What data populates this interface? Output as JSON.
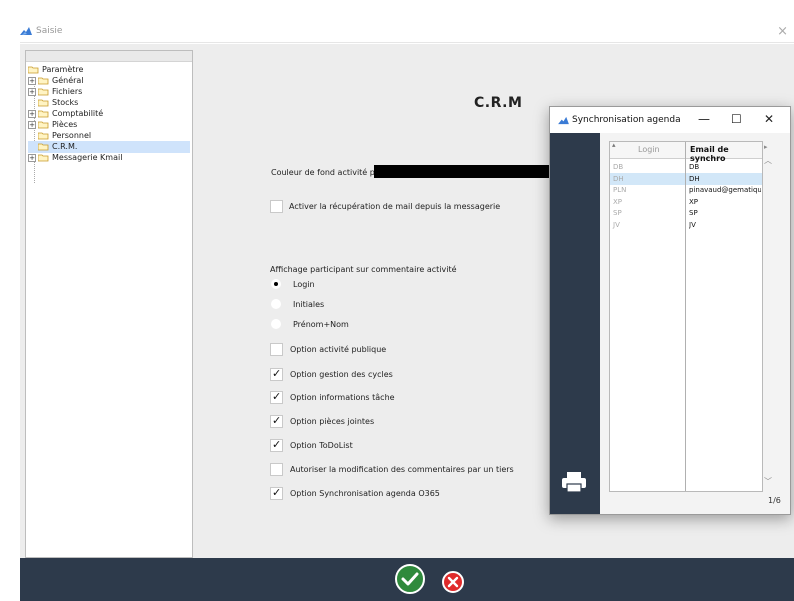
{
  "window": {
    "title": "Saisie",
    "close": "×"
  },
  "tree": {
    "root": "Paramètre",
    "items": [
      {
        "label": "Général",
        "expandable": true
      },
      {
        "label": "Fichiers",
        "expandable": true
      },
      {
        "label": "Stocks",
        "expandable": false
      },
      {
        "label": "Comptabilité",
        "expandable": true
      },
      {
        "label": "Pièces",
        "expandable": true
      },
      {
        "label": "Personnel",
        "expandable": false
      },
      {
        "label": "C.R.M.",
        "expandable": false,
        "selected": true
      },
      {
        "label": "Messagerie Kmail",
        "expandable": true
      }
    ]
  },
  "page": {
    "title": "C.R.M"
  },
  "form": {
    "color_label": "Couleur de fond activité public",
    "color_value": "#000000",
    "mail_recovery_label": "Activer la récupération de mail depuis la messagerie",
    "participant_label": "Affichage participant sur commentaire activité",
    "radios": [
      {
        "label": "Login",
        "selected": true
      },
      {
        "label": "Initiales",
        "selected": false
      },
      {
        "label": "Prénom+Nom",
        "selected": false
      }
    ],
    "options": [
      {
        "label": "Option activité publique",
        "checked": false
      },
      {
        "label": "Option gestion des cycles",
        "checked": true
      },
      {
        "label": "Option informations tâche",
        "checked": true
      },
      {
        "label": "Option pièces jointes",
        "checked": true
      },
      {
        "label": "Option ToDoList",
        "checked": true
      },
      {
        "label": "Autoriser la modification des commentaires par un tiers",
        "checked": false
      },
      {
        "label": "Option Synchronisation agenda O365",
        "checked": true
      }
    ]
  },
  "sync": {
    "title": "Synchronisation agenda",
    "minimize": "—",
    "maximize": "☐",
    "close": "✕",
    "columns": [
      "Login",
      "Email de synchro"
    ],
    "rows": [
      {
        "login": "DB",
        "email": "DB"
      },
      {
        "login": "DH",
        "email": "DH",
        "selected": true
      },
      {
        "login": "PLN",
        "email": "pinavaud@gematiqu"
      },
      {
        "login": "XP",
        "email": "XP"
      },
      {
        "login": "SP",
        "email": "SP"
      },
      {
        "login": "JV",
        "email": "JV"
      }
    ],
    "pager": "1/6"
  },
  "colors": {
    "sidebar": "#2d3a4b",
    "ok": "#2f8a3c",
    "cancel": "#e02b2b",
    "selection": "#cfe3fb"
  },
  "icons": {
    "ok": "check-icon",
    "cancel": "close-circle-icon",
    "print": "printer-icon",
    "folder": "folder-icon"
  }
}
